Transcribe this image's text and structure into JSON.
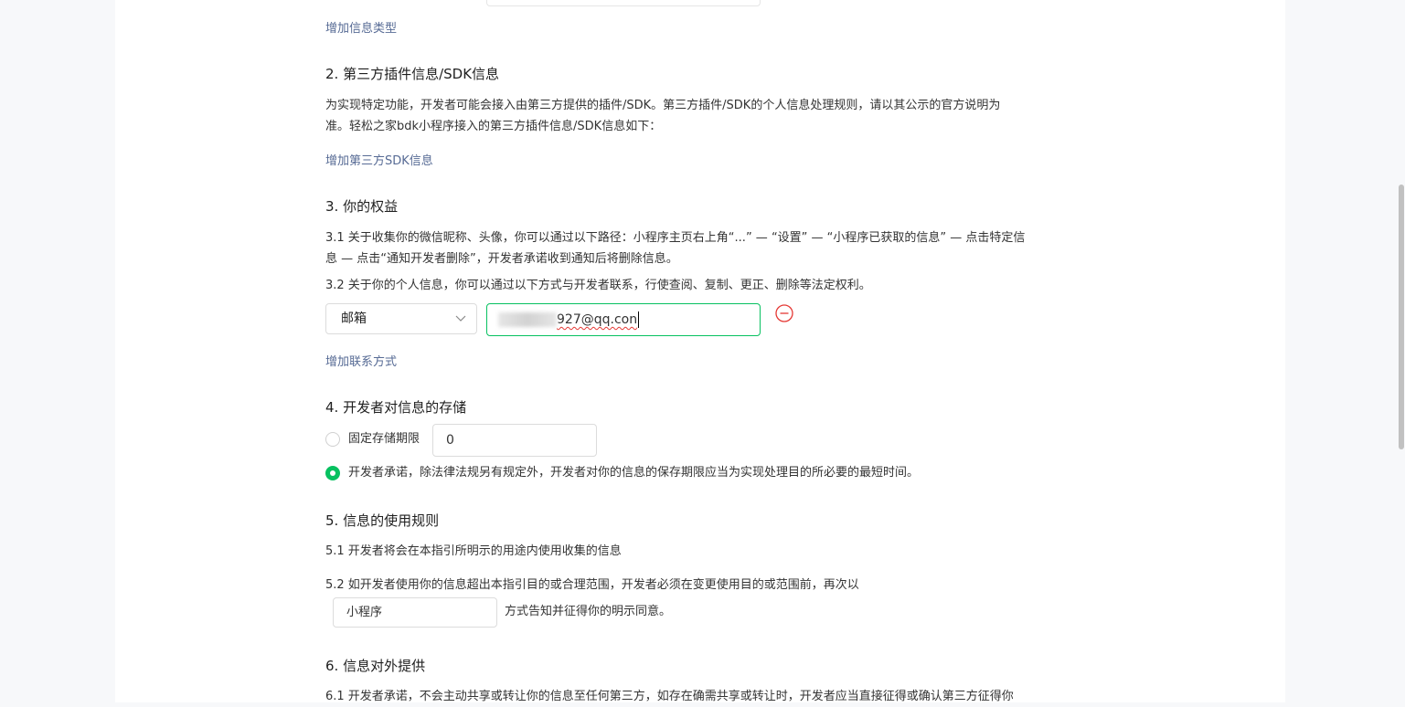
{
  "top": {
    "add_info_type": "增加信息类型"
  },
  "section2": {
    "title": "2.  第三方插件信息/SDK信息",
    "para_line1": "为实现特定功能，开发者可能会接入由第三方提供的插件/SDK。第三方插件/SDK的个人信息处理规则，请以其公示的官方说明为",
    "para_line2": "准。轻松之家bdk小程序接入的第三方插件信息/SDK信息如下：",
    "add_sdk": "增加第三方SDK信息"
  },
  "section3": {
    "title": "3.  你的权益",
    "item1_line1": "3.1   关于收集你的微信昵称、头像，你可以通过以下路径：小程序主页右上角“...” — “设置” — “小程序已获取的信息” — 点击特定信",
    "item1_line2": "息 — 点击“通知开发者删除”，开发者承诺收到通知后将删除信息。",
    "item2": "3.2   关于你的个人信息，你可以通过以下方式与开发者联系，行使查阅、复制、更正、删除等法定权利。",
    "contact_type": "邮箱",
    "contact_value": "927@qq.con",
    "add_contact": "增加联系方式"
  },
  "section4": {
    "title": "4.  开发者对信息的存储",
    "option1_label": "固定存储期限",
    "option1_value": "0",
    "option2_label": "开发者承诺，除法律法规另有规定外，开发者对你的信息的保存期限应当为实现处理目的所必要的最短时间。"
  },
  "section5": {
    "title": "5.  信息的使用规则",
    "item1": "5.1   开发者将会在本指引所明示的用途内使用收集的信息",
    "item2": "5.2   如开发者使用你的信息超出本指引目的或合理范围，开发者必须在变更使用目的或范围前，再次以",
    "method_value": "小程序",
    "item2_suffix": "方式告知并征得你的明示同意。"
  },
  "section6": {
    "title": "6.  信息对外提供",
    "item1": "6.1   开发者承诺，不会主动共享或转让你的信息至任何第三方，如存在确需共享或转让时，开发者应当直接征得或确认第三方征得你"
  },
  "colors": {
    "accent": "#07c160",
    "link": "#576b95",
    "danger": "#e53935"
  },
  "icons": {
    "select_arrow": "chevron-down-icon",
    "remove": "minus-circle-icon"
  }
}
